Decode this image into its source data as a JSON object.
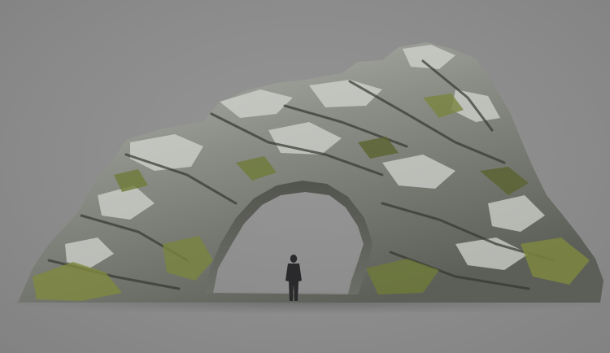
{
  "scene": {
    "subject": "rock-arch",
    "figure": "human-silhouette",
    "background_color": "#8c8c8c",
    "rock_colors": {
      "light": "#c9cbc6",
      "mid": "#8d9088",
      "dark": "#3e403b",
      "moss": "#7f8a3f",
      "moss_dark": "#5b6330"
    },
    "figure_color": "#2a2a2c"
  }
}
